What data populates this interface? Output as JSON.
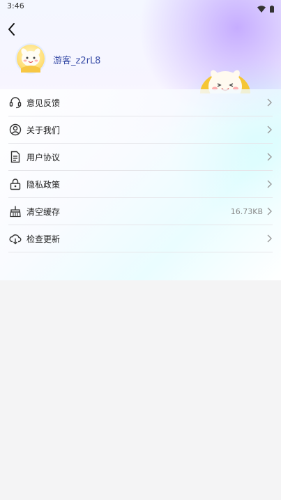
{
  "status_bar": {
    "time": "3:46",
    "wifi_icon": "wifi-icon",
    "battery_icon": "battery-icon"
  },
  "header": {
    "back_icon": "chevron-left-icon"
  },
  "profile": {
    "username": "游客_z2rL8",
    "avatar_icon": "avatar"
  },
  "menu": {
    "items": [
      {
        "label": "意见反馈",
        "icon": "headset-icon"
      },
      {
        "label": "关于我们",
        "icon": "user-circle-icon"
      },
      {
        "label": "用户协议",
        "icon": "document-icon"
      },
      {
        "label": "隐私政策",
        "icon": "lock-icon"
      },
      {
        "label": "清空缓存",
        "icon": "broom-icon",
        "value": "16.73KB"
      },
      {
        "label": "检查更新",
        "icon": "cloud-icon"
      }
    ]
  },
  "colors": {
    "username": "#3a4ea8",
    "divider": "#e6e6ea",
    "background": "#f4f4f5"
  }
}
